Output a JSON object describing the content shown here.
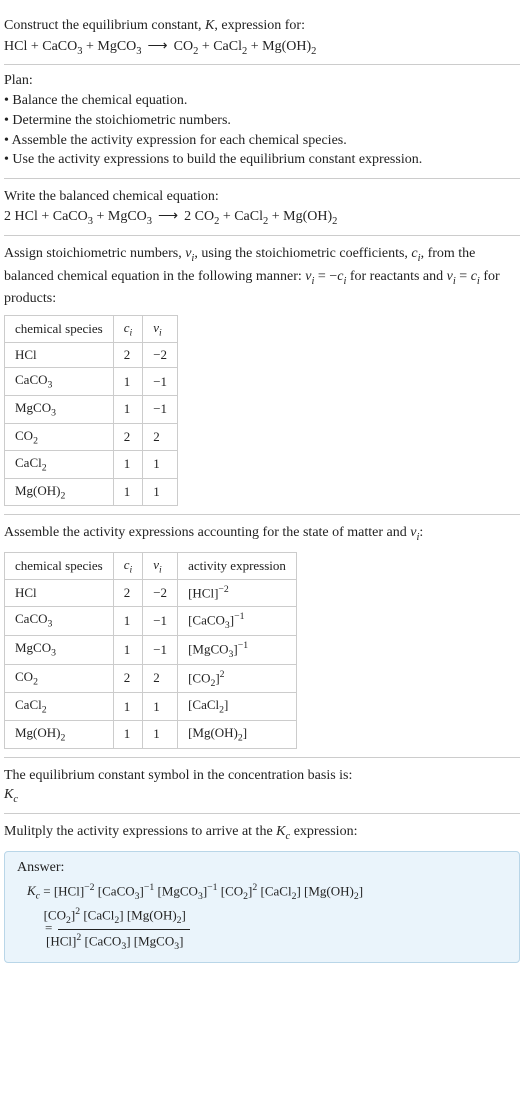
{
  "intro": {
    "line1": "Construct the equilibrium constant, K, expression for:",
    "equation_lhs": "HCl + CaCO",
    "equation": "HCl + CaCO₃ + MgCO₃  ⟶  CO₂ + CaCl₂ + Mg(OH)₂"
  },
  "plan": {
    "title": "Plan:",
    "items": [
      "• Balance the chemical equation.",
      "• Determine the stoichiometric numbers.",
      "• Assemble the activity expression for each chemical species.",
      "• Use the activity expressions to build the equilibrium constant expression."
    ]
  },
  "balanced": {
    "title": "Write the balanced chemical equation:",
    "equation": "2 HCl + CaCO₃ + MgCO₃  ⟶  2 CO₂ + CaCl₂ + Mg(OH)₂"
  },
  "stoich_intro": "Assign stoichiometric numbers, νᵢ, using the stoichiometric coefficients, cᵢ, from the balanced chemical equation in the following manner: νᵢ = −cᵢ for reactants and νᵢ = cᵢ for products:",
  "table1": {
    "headers": [
      "chemical species",
      "cᵢ",
      "νᵢ"
    ],
    "rows": [
      [
        "HCl",
        "2",
        "−2"
      ],
      [
        "CaCO₃",
        "1",
        "−1"
      ],
      [
        "MgCO₃",
        "1",
        "−1"
      ],
      [
        "CO₂",
        "2",
        "2"
      ],
      [
        "CaCl₂",
        "1",
        "1"
      ],
      [
        "Mg(OH)₂",
        "1",
        "1"
      ]
    ]
  },
  "activity_intro": "Assemble the activity expressions accounting for the state of matter and νᵢ:",
  "table2": {
    "headers": [
      "chemical species",
      "cᵢ",
      "νᵢ",
      "activity expression"
    ],
    "rows": [
      [
        "HCl",
        "2",
        "−2",
        "[HCl]⁻²"
      ],
      [
        "CaCO₃",
        "1",
        "−1",
        "[CaCO₃]⁻¹"
      ],
      [
        "MgCO₃",
        "1",
        "−1",
        "[MgCO₃]⁻¹"
      ],
      [
        "CO₂",
        "2",
        "2",
        "[CO₂]²"
      ],
      [
        "CaCl₂",
        "1",
        "1",
        "[CaCl₂]"
      ],
      [
        "Mg(OH)₂",
        "1",
        "1",
        "[Mg(OH)₂]"
      ]
    ]
  },
  "kc_basis": {
    "line": "The equilibrium constant symbol in the concentration basis is:",
    "symbol": "K_c"
  },
  "multiply_intro": "Mulitply the activity expressions to arrive at the K_c expression:",
  "answer": {
    "title": "Answer:",
    "lhs": "K_c",
    "rhs_flat": "[HCl]⁻² [CaCO₃]⁻¹ [MgCO₃]⁻¹ [CO₂]² [CaCl₂] [Mg(OH)₂]",
    "frac_num": "[CO₂]² [CaCl₂] [Mg(OH)₂]",
    "frac_den": "[HCl]² [CaCO₃] [MgCO₃]"
  },
  "chart_data": {
    "type": "table",
    "tables": [
      {
        "title": "stoichiometric numbers",
        "columns": [
          "chemical species",
          "c_i",
          "nu_i"
        ],
        "rows": [
          {
            "chemical species": "HCl",
            "c_i": 2,
            "nu_i": -2
          },
          {
            "chemical species": "CaCO3",
            "c_i": 1,
            "nu_i": -1
          },
          {
            "chemical species": "MgCO3",
            "c_i": 1,
            "nu_i": -1
          },
          {
            "chemical species": "CO2",
            "c_i": 2,
            "nu_i": 2
          },
          {
            "chemical species": "CaCl2",
            "c_i": 1,
            "nu_i": 1
          },
          {
            "chemical species": "Mg(OH)2",
            "c_i": 1,
            "nu_i": 1
          }
        ]
      },
      {
        "title": "activity expressions",
        "columns": [
          "chemical species",
          "c_i",
          "nu_i",
          "activity expression"
        ],
        "rows": [
          {
            "chemical species": "HCl",
            "c_i": 2,
            "nu_i": -2,
            "activity expression": "[HCl]^-2"
          },
          {
            "chemical species": "CaCO3",
            "c_i": 1,
            "nu_i": -1,
            "activity expression": "[CaCO3]^-1"
          },
          {
            "chemical species": "MgCO3",
            "c_i": 1,
            "nu_i": -1,
            "activity expression": "[MgCO3]^-1"
          },
          {
            "chemical species": "CO2",
            "c_i": 2,
            "nu_i": 2,
            "activity expression": "[CO2]^2"
          },
          {
            "chemical species": "CaCl2",
            "c_i": 1,
            "nu_i": 1,
            "activity expression": "[CaCl2]"
          },
          {
            "chemical species": "Mg(OH)2",
            "c_i": 1,
            "nu_i": 1,
            "activity expression": "[Mg(OH)2]"
          }
        ]
      }
    ]
  }
}
